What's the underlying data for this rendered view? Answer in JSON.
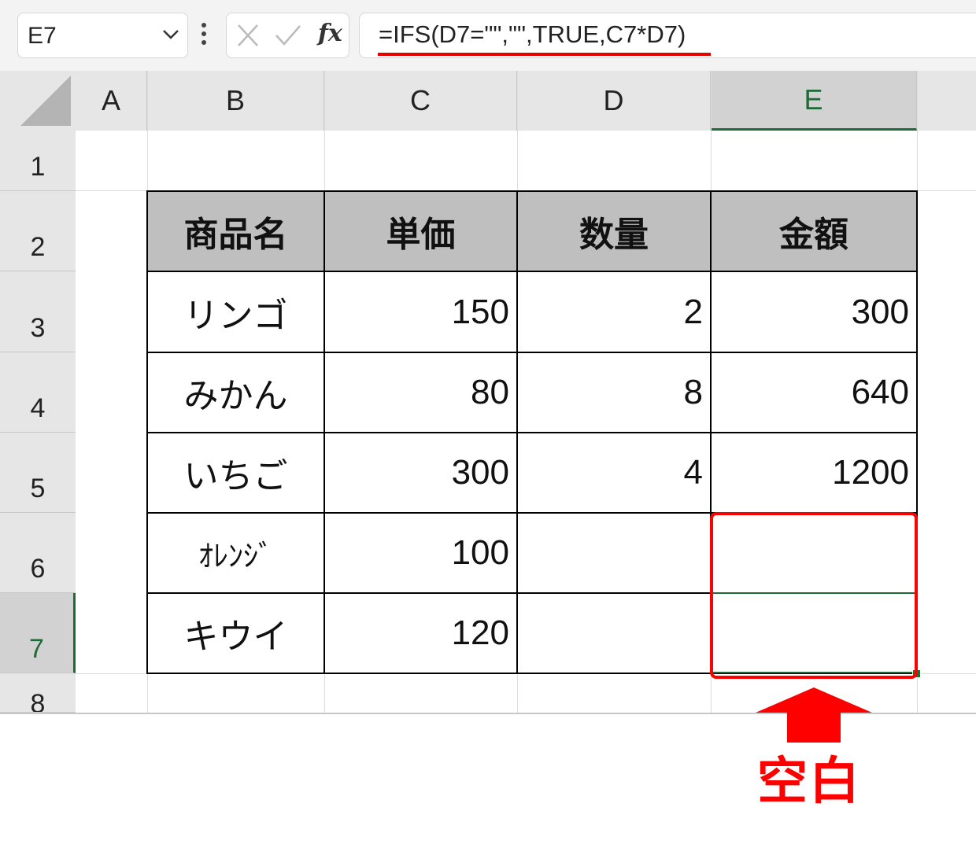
{
  "formula_bar": {
    "name_box": "E7",
    "fx_label": "fx",
    "formula": "=IFS(D7=\"\",\"\",TRUE,C7*D7)"
  },
  "columns": [
    "A",
    "B",
    "C",
    "D",
    "E"
  ],
  "rows": [
    "1",
    "2",
    "3",
    "4",
    "5",
    "6",
    "7",
    "8"
  ],
  "table": {
    "headers": [
      "商品名",
      "単価",
      "数量",
      "金額"
    ],
    "rows": [
      {
        "name": "リンゴ",
        "price": "150",
        "qty": "2",
        "amount": "300"
      },
      {
        "name": "みかん",
        "price": "80",
        "qty": "8",
        "amount": "640"
      },
      {
        "name": "いちご",
        "price": "300",
        "qty": "4",
        "amount": "1200"
      },
      {
        "name": "ｵﾚﾝｼﾞ",
        "price": "100",
        "qty": "",
        "amount": ""
      },
      {
        "name": "キウイ",
        "price": "120",
        "qty": "",
        "amount": ""
      }
    ]
  },
  "annotation": {
    "label": "空白",
    "color": "#ff0000"
  },
  "colors": {
    "selection": "#1f6b37",
    "header_fill": "#bfbfbf",
    "highlight": "#ff0000"
  }
}
